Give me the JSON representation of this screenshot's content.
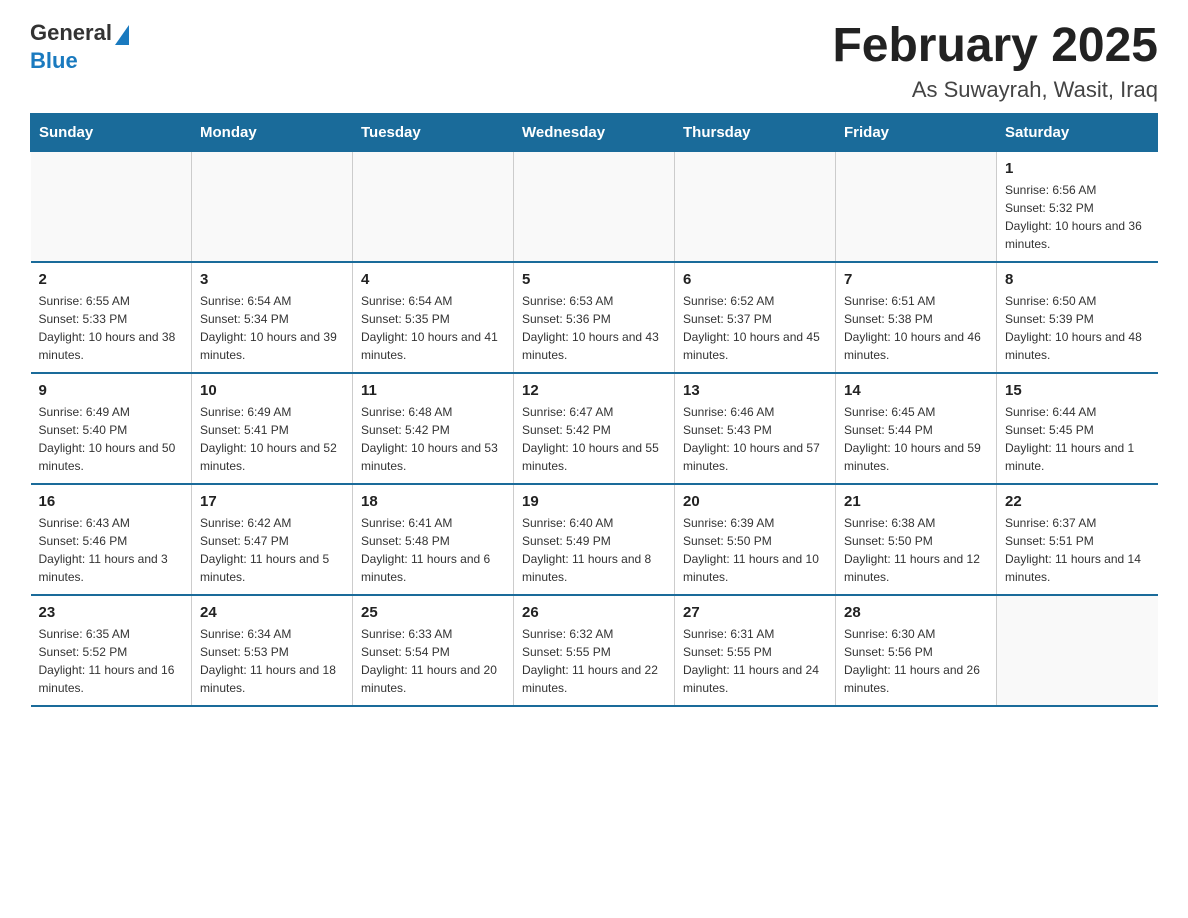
{
  "logo": {
    "general": "General",
    "blue": "Blue"
  },
  "title": "February 2025",
  "subtitle": "As Suwayrah, Wasit, Iraq",
  "calendar": {
    "headers": [
      "Sunday",
      "Monday",
      "Tuesday",
      "Wednesday",
      "Thursday",
      "Friday",
      "Saturday"
    ],
    "weeks": [
      [
        {
          "day": "",
          "info": ""
        },
        {
          "day": "",
          "info": ""
        },
        {
          "day": "",
          "info": ""
        },
        {
          "day": "",
          "info": ""
        },
        {
          "day": "",
          "info": ""
        },
        {
          "day": "",
          "info": ""
        },
        {
          "day": "1",
          "info": "Sunrise: 6:56 AM\nSunset: 5:32 PM\nDaylight: 10 hours and 36 minutes."
        }
      ],
      [
        {
          "day": "2",
          "info": "Sunrise: 6:55 AM\nSunset: 5:33 PM\nDaylight: 10 hours and 38 minutes."
        },
        {
          "day": "3",
          "info": "Sunrise: 6:54 AM\nSunset: 5:34 PM\nDaylight: 10 hours and 39 minutes."
        },
        {
          "day": "4",
          "info": "Sunrise: 6:54 AM\nSunset: 5:35 PM\nDaylight: 10 hours and 41 minutes."
        },
        {
          "day": "5",
          "info": "Sunrise: 6:53 AM\nSunset: 5:36 PM\nDaylight: 10 hours and 43 minutes."
        },
        {
          "day": "6",
          "info": "Sunrise: 6:52 AM\nSunset: 5:37 PM\nDaylight: 10 hours and 45 minutes."
        },
        {
          "day": "7",
          "info": "Sunrise: 6:51 AM\nSunset: 5:38 PM\nDaylight: 10 hours and 46 minutes."
        },
        {
          "day": "8",
          "info": "Sunrise: 6:50 AM\nSunset: 5:39 PM\nDaylight: 10 hours and 48 minutes."
        }
      ],
      [
        {
          "day": "9",
          "info": "Sunrise: 6:49 AM\nSunset: 5:40 PM\nDaylight: 10 hours and 50 minutes."
        },
        {
          "day": "10",
          "info": "Sunrise: 6:49 AM\nSunset: 5:41 PM\nDaylight: 10 hours and 52 minutes."
        },
        {
          "day": "11",
          "info": "Sunrise: 6:48 AM\nSunset: 5:42 PM\nDaylight: 10 hours and 53 minutes."
        },
        {
          "day": "12",
          "info": "Sunrise: 6:47 AM\nSunset: 5:42 PM\nDaylight: 10 hours and 55 minutes."
        },
        {
          "day": "13",
          "info": "Sunrise: 6:46 AM\nSunset: 5:43 PM\nDaylight: 10 hours and 57 minutes."
        },
        {
          "day": "14",
          "info": "Sunrise: 6:45 AM\nSunset: 5:44 PM\nDaylight: 10 hours and 59 minutes."
        },
        {
          "day": "15",
          "info": "Sunrise: 6:44 AM\nSunset: 5:45 PM\nDaylight: 11 hours and 1 minute."
        }
      ],
      [
        {
          "day": "16",
          "info": "Sunrise: 6:43 AM\nSunset: 5:46 PM\nDaylight: 11 hours and 3 minutes."
        },
        {
          "day": "17",
          "info": "Sunrise: 6:42 AM\nSunset: 5:47 PM\nDaylight: 11 hours and 5 minutes."
        },
        {
          "day": "18",
          "info": "Sunrise: 6:41 AM\nSunset: 5:48 PM\nDaylight: 11 hours and 6 minutes."
        },
        {
          "day": "19",
          "info": "Sunrise: 6:40 AM\nSunset: 5:49 PM\nDaylight: 11 hours and 8 minutes."
        },
        {
          "day": "20",
          "info": "Sunrise: 6:39 AM\nSunset: 5:50 PM\nDaylight: 11 hours and 10 minutes."
        },
        {
          "day": "21",
          "info": "Sunrise: 6:38 AM\nSunset: 5:50 PM\nDaylight: 11 hours and 12 minutes."
        },
        {
          "day": "22",
          "info": "Sunrise: 6:37 AM\nSunset: 5:51 PM\nDaylight: 11 hours and 14 minutes."
        }
      ],
      [
        {
          "day": "23",
          "info": "Sunrise: 6:35 AM\nSunset: 5:52 PM\nDaylight: 11 hours and 16 minutes."
        },
        {
          "day": "24",
          "info": "Sunrise: 6:34 AM\nSunset: 5:53 PM\nDaylight: 11 hours and 18 minutes."
        },
        {
          "day": "25",
          "info": "Sunrise: 6:33 AM\nSunset: 5:54 PM\nDaylight: 11 hours and 20 minutes."
        },
        {
          "day": "26",
          "info": "Sunrise: 6:32 AM\nSunset: 5:55 PM\nDaylight: 11 hours and 22 minutes."
        },
        {
          "day": "27",
          "info": "Sunrise: 6:31 AM\nSunset: 5:55 PM\nDaylight: 11 hours and 24 minutes."
        },
        {
          "day": "28",
          "info": "Sunrise: 6:30 AM\nSunset: 5:56 PM\nDaylight: 11 hours and 26 minutes."
        },
        {
          "day": "",
          "info": ""
        }
      ]
    ]
  }
}
